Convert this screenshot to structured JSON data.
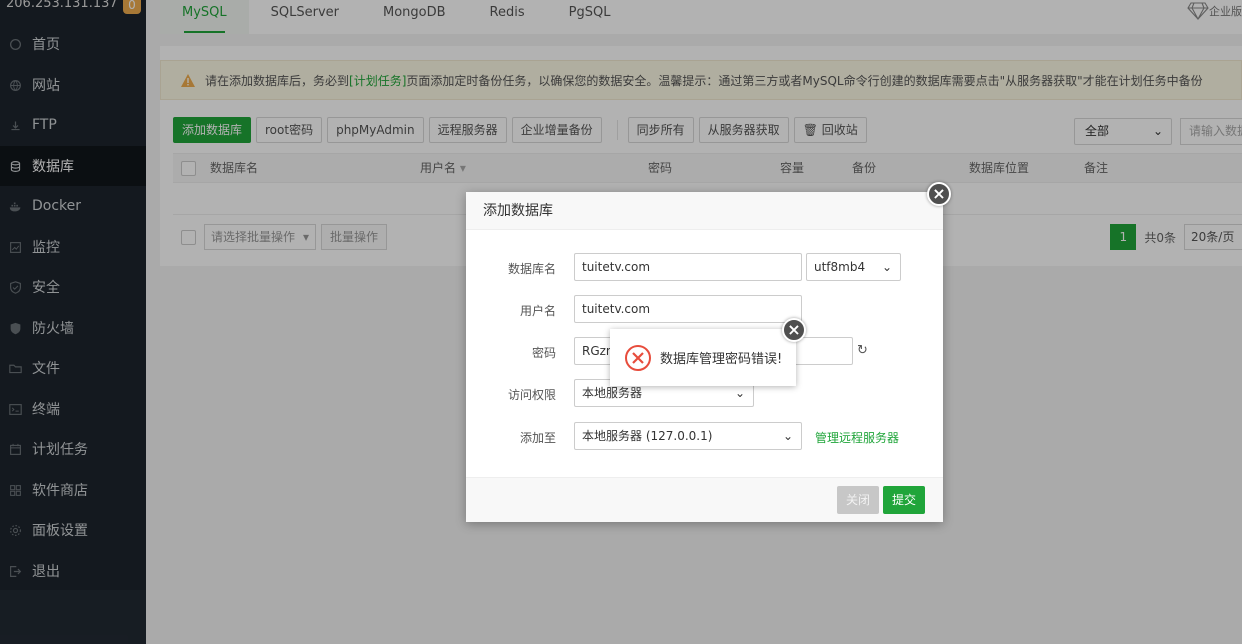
{
  "sidebar": {
    "server": "206.253.131.137",
    "badge": "0",
    "items": [
      {
        "label": "首页",
        "icon": "home-icon"
      },
      {
        "label": "网站",
        "icon": "globe-icon"
      },
      {
        "label": "FTP",
        "icon": "ftp-icon"
      },
      {
        "label": "数据库",
        "icon": "database-icon",
        "active": true
      },
      {
        "label": "Docker",
        "icon": "docker-icon"
      },
      {
        "label": "监控",
        "icon": "monitor-icon"
      },
      {
        "label": "安全",
        "icon": "shield-icon"
      },
      {
        "label": "防火墙",
        "icon": "firewall-icon"
      },
      {
        "label": "文件",
        "icon": "folder-icon"
      },
      {
        "label": "终端",
        "icon": "terminal-icon"
      },
      {
        "label": "计划任务",
        "icon": "calendar-icon"
      },
      {
        "label": "软件商店",
        "icon": "grid-icon"
      },
      {
        "label": "面板设置",
        "icon": "gear-icon"
      },
      {
        "label": "退出",
        "icon": "logout-icon"
      }
    ]
  },
  "tabs": [
    "MySQL",
    "SQLServer",
    "MongoDB",
    "Redis",
    "PgSQL"
  ],
  "enterprise_label": "企业版",
  "notice": {
    "before": "请在添加数据库后，务必到",
    "link": "[计划任务]",
    "after": "页面添加定时备份任务，以确保您的数据安全。温馨提示：通过第三方或者MySQL命令行创建的数据库需要点击\"从服务器获取\"才能在计划任务中备份"
  },
  "toolbar": {
    "add_db": "添加数据库",
    "root_pwd": "root密码",
    "phpmyadmin": "phpMyAdmin",
    "remote_server": "远程服务器",
    "enterprise_backup": "企业增量备份",
    "sync_all": "同步所有",
    "fetch_from_server": "从服务器获取",
    "recycle_bin": "回收站",
    "filter_all": "全部",
    "search_placeholder": "请输入数据库名称"
  },
  "table": {
    "headers": [
      "数据库名",
      "用户名",
      "密码",
      "容量",
      "备份",
      "数据库位置",
      "备注"
    ]
  },
  "footer": {
    "batch_placeholder": "请选择批量操作",
    "batch_btn": "批量操作",
    "page": "1",
    "total": "共0条",
    "page_size": "20条/页"
  },
  "dialog": {
    "title": "添加数据库",
    "db_name_label": "数据库名",
    "db_name_value": "tuitetv.com",
    "charset": "utf8mb4",
    "username_label": "用户名",
    "username_value": "tuitetv.com",
    "password_label": "密码",
    "password_value": "RGznl",
    "access_label": "访问权限",
    "access_value": "本地服务器",
    "add_to_label": "添加至",
    "add_to_value": "本地服务器 (127.0.0.1)",
    "manage_remote": "管理远程服务器",
    "cancel": "关闭",
    "submit": "提交"
  },
  "toast": {
    "message": "数据库管理密码错误!"
  },
  "colors": {
    "accent": "#20a53a",
    "sidebar_bg": "#1e252d",
    "error": "#e74c3c"
  }
}
